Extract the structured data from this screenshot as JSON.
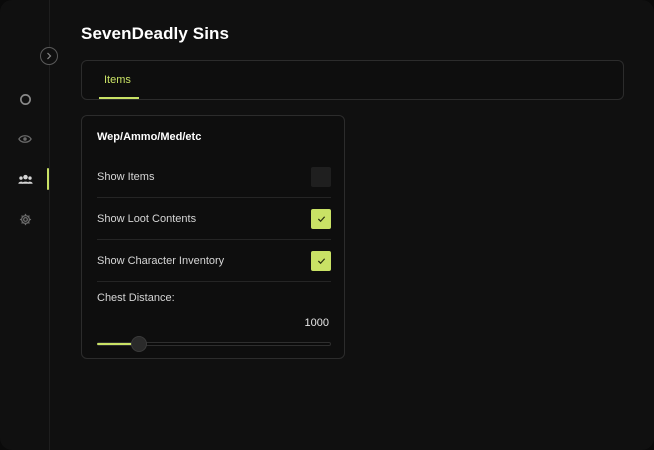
{
  "app": {
    "title": "SevenDeadly Sins"
  },
  "sidebar": {
    "collapse_icon": "chevron-right-icon",
    "items": [
      {
        "icon": "circle-icon",
        "active": false
      },
      {
        "icon": "eye-icon",
        "active": false
      },
      {
        "icon": "users-icon",
        "active": true
      },
      {
        "icon": "gear-icon",
        "active": false
      }
    ]
  },
  "tabs": [
    {
      "label": "Items",
      "active": true
    }
  ],
  "panel": {
    "title": "Wep/Ammo/Med/etc",
    "options": [
      {
        "label": "Show Items",
        "checked": false
      },
      {
        "label": "Show Loot Contents",
        "checked": true
      },
      {
        "label": "Show Character Inventory",
        "checked": true
      }
    ],
    "chest_distance": {
      "label": "Chest Distance:",
      "value": "1000",
      "fill_fraction": 0.18
    }
  },
  "colors": {
    "accent": "#c9e265",
    "background": "#101010",
    "panel_border": "#2c2c2c"
  }
}
